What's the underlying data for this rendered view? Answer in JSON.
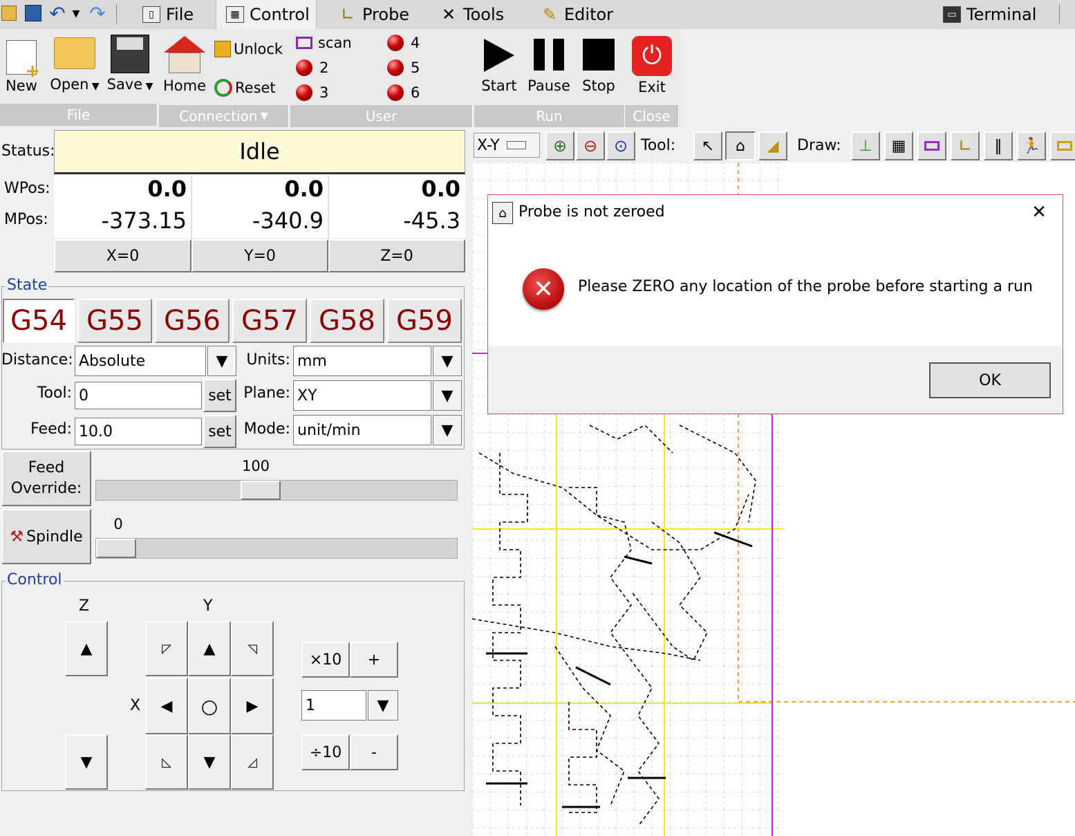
{
  "topbar": {
    "tabs": [
      {
        "label": "File",
        "icon": "file-icon"
      },
      {
        "label": "Control",
        "icon": "control-icon"
      },
      {
        "label": "Probe",
        "icon": "probe-icon"
      },
      {
        "label": "Tools",
        "icon": "tools-icon"
      },
      {
        "label": "Editor",
        "icon": "editor-icon"
      }
    ],
    "terminal": "Terminal"
  },
  "ribbon": {
    "file": {
      "new": "New",
      "open": "Open",
      "save": "Save",
      "group": "File"
    },
    "connection": {
      "home": "Home",
      "unlock": "Unlock",
      "reset": "Reset",
      "group": "Connection"
    },
    "user": {
      "scan": "scan",
      "b2": "2",
      "b3": "3",
      "b4": "4",
      "b5": "5",
      "b6": "6",
      "group": "User"
    },
    "run": {
      "start": "Start",
      "pause": "Pause",
      "stop": "Stop",
      "group": "Run"
    },
    "close": {
      "exit": "Exit",
      "group": "Close"
    }
  },
  "status": {
    "label": "Status:",
    "value": "Idle",
    "wpos_label": "WPos:",
    "mpos_label": "MPos:",
    "wpos": [
      "0.0",
      "0.0",
      "0.0"
    ],
    "mpos": [
      "-373.15",
      "-340.9",
      "-45.3"
    ],
    "zero_buttons": [
      "X=0",
      "Y=0",
      "Z=0"
    ]
  },
  "state": {
    "title": "State",
    "wcs": [
      "G54",
      "G55",
      "G56",
      "G57",
      "G58",
      "G59"
    ],
    "distance_label": "Distance:",
    "distance": "Absolute",
    "units_label": "Units:",
    "units": "mm",
    "tool_label": "Tool:",
    "tool": "0",
    "plane_label": "Plane:",
    "plane": "XY",
    "feed_label": "Feed:",
    "feed": "10.0",
    "mode_label": "Mode:",
    "mode": "unit/min",
    "set": "set",
    "feed_override_label_1": "Feed",
    "feed_override_label_2": "Override:",
    "feed_override_value": "100",
    "feed_override_fraction": 0.45,
    "spindle_label": "Spindle",
    "spindle_value": "0",
    "spindle_fraction": 0.0
  },
  "control": {
    "title": "Control",
    "z_label": "Z",
    "y_label": "Y",
    "x_label": "X",
    "times10": "×10",
    "plus": "+",
    "step": "1",
    "div10": "÷10",
    "minus": "-"
  },
  "canvas_toolbar": {
    "view": "X-Y",
    "tool_label": "Tool:",
    "draw_label": "Draw:"
  },
  "dialog": {
    "title": "Probe is not zeroed",
    "message": "Please ZERO any location of the probe before starting a run",
    "ok": "OK"
  }
}
